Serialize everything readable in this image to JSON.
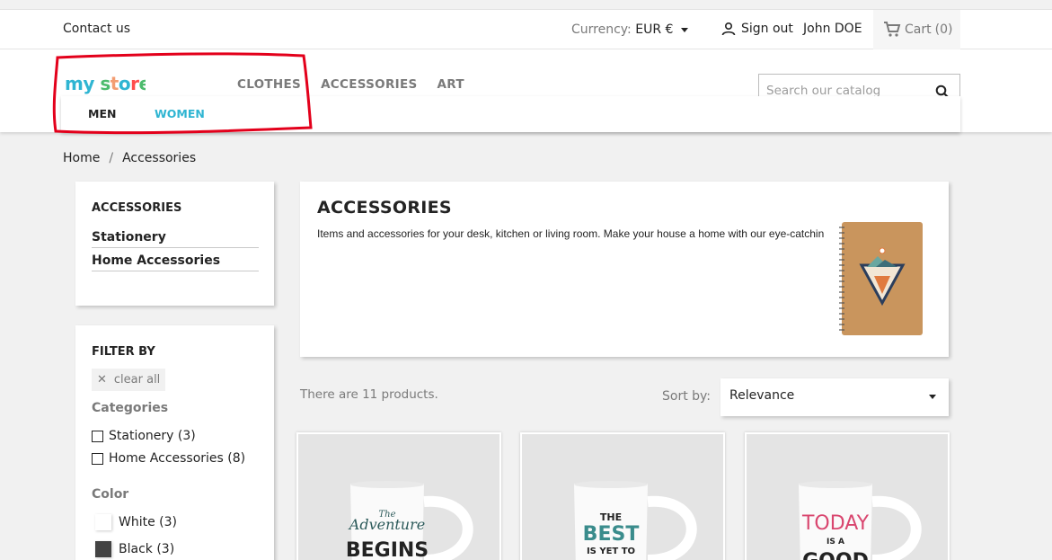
{
  "topbar": {
    "contact": "Contact us",
    "currency_label": "Currency:",
    "currency_value": "EUR €",
    "sign_out": "Sign out",
    "user_name": "John DOE",
    "cart_label": "Cart",
    "cart_count": "(0)"
  },
  "header": {
    "logo_text": "my store",
    "nav": [
      "CLOTHES",
      "ACCESSORIES",
      "ART"
    ],
    "search_placeholder": "Search our catalog"
  },
  "submenu": {
    "items": [
      "MEN",
      "WOMEN"
    ]
  },
  "breadcrumb": {
    "items": [
      "Home",
      "Accessories"
    ],
    "separator": "/"
  },
  "sidebar": {
    "title": "ACCESSORIES",
    "subcategories": [
      "Stationery",
      "Home Accessories"
    ]
  },
  "filters": {
    "title": "FILTER BY",
    "clear_all": "clear all",
    "categories_title": "Categories",
    "categories": [
      "Stationery (3)",
      "Home Accessories (8)"
    ],
    "color_title": "Color",
    "colors": [
      {
        "label": "White (3)",
        "hex": "#ffffff"
      },
      {
        "label": "Black (3)",
        "hex": "#434343"
      }
    ]
  },
  "category": {
    "title": "ACCESSORIES",
    "description": "Items and accessories for your desk, kitchen or living room. Make your house a home with our eye-catching designs."
  },
  "listing": {
    "count_text": "There are 11 products.",
    "sort_label": "Sort by:",
    "sort_value": "Relevance"
  },
  "products": [
    {
      "mug_text_top": "The",
      "mug_text_mid": "Adventure",
      "mug_text_bottom": "BEGINS"
    },
    {
      "mug_text_top": "THE",
      "mug_text_mid": "BEST",
      "mug_text_bottom": "IS YET TO"
    },
    {
      "mug_text_top": "TODAY",
      "mug_text_mid": "IS A",
      "mug_text_bottom": "GOOD"
    }
  ],
  "colors": {
    "accent": "#2fb5d2",
    "annotation_red": "#e3001b"
  }
}
